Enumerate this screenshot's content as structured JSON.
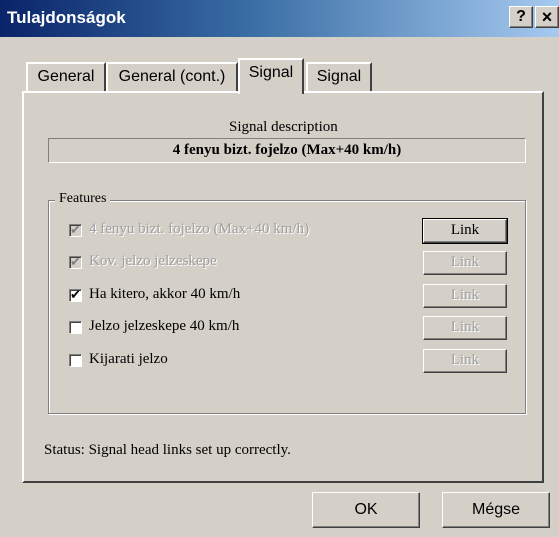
{
  "window": {
    "title": "Tulajdonságok",
    "help_glyph": "?",
    "close_glyph": "×"
  },
  "tabs": [
    {
      "label": "General",
      "active": false
    },
    {
      "label": "General (cont.)",
      "active": false
    },
    {
      "label": "Signal",
      "active": true
    },
    {
      "label": "Signal",
      "active": false
    }
  ],
  "signal": {
    "description_label": "Signal description",
    "description_value": "4 fenyu bizt. fojelzo (Max+40 km/h)"
  },
  "features": {
    "legend": "Features",
    "items": [
      {
        "label": "4 fenyu bizt. fojelzo (Max+40 km/h)",
        "checked": true,
        "enabled": false,
        "check_glyph": "✔",
        "link_label": "Link",
        "link_enabled": true
      },
      {
        "label": "Kov. jelzo jelzeskepe",
        "checked": true,
        "enabled": false,
        "check_glyph": "✔",
        "link_label": "Link",
        "link_enabled": false
      },
      {
        "label": "Ha kitero, akkor 40 km/h",
        "checked": true,
        "enabled": true,
        "check_glyph": "✔",
        "link_label": "Link",
        "link_enabled": false
      },
      {
        "label": "Jelzo jelzeskepe 40 km/h",
        "checked": false,
        "enabled": true,
        "check_glyph": "",
        "link_label": "Link",
        "link_enabled": false
      },
      {
        "label": "Kijarati jelzo",
        "checked": false,
        "enabled": true,
        "check_glyph": "",
        "link_label": "Link",
        "link_enabled": false
      }
    ]
  },
  "status": {
    "text": "Status: Signal head links set up correctly."
  },
  "buttons": {
    "ok": "OK",
    "cancel": "Mégse"
  }
}
